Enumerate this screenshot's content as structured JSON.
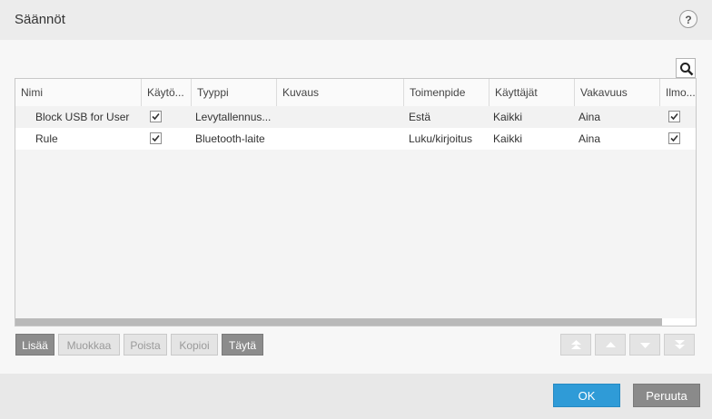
{
  "window": {
    "title": "Säännöt",
    "help_label": "?"
  },
  "table": {
    "columns": [
      "Nimi",
      "Käytö...",
      "Tyyppi",
      "Kuvaus",
      "Toimenpide",
      "Käyttäjät",
      "Vakavuus",
      "Ilmo..."
    ],
    "rows": [
      {
        "name": "Block USB for User",
        "enabled": true,
        "type": "Levytallennus...",
        "description": "",
        "action": "Estä",
        "users": "Kaikki",
        "severity": "Aina",
        "notify": true
      },
      {
        "name": "Rule",
        "enabled": true,
        "type": "Bluetooth-laite",
        "description": "",
        "action": "Luku/kirjoitus",
        "users": "Kaikki",
        "severity": "Aina",
        "notify": true
      }
    ]
  },
  "toolbar": {
    "add": "Lisää",
    "edit": "Muokkaa",
    "delete": "Poista",
    "copy": "Kopioi",
    "populate": "Täytä"
  },
  "move_buttons": [
    "move-top-icon",
    "move-up-icon",
    "move-down-icon",
    "move-bottom-icon"
  ],
  "footer": {
    "ok": "OK",
    "cancel": "Peruuta"
  },
  "colors": {
    "ok_button": "#2f9bd7",
    "cancel_button": "#8a8a8a",
    "active_toolbar": "#8c8c8c"
  }
}
